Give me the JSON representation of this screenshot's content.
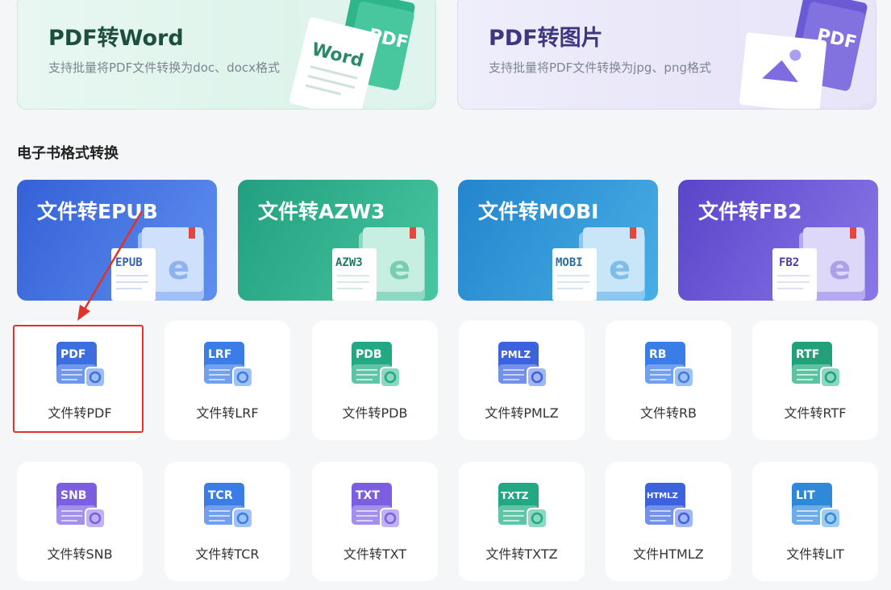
{
  "promos": [
    {
      "title": "PDF转Word",
      "subtitle": "支持批量将PDF文件转换为doc、docx格式",
      "badge": "Word",
      "badge2": "PDF"
    },
    {
      "title": "PDF转图片",
      "subtitle": "支持批量将PDF文件转换为jpg、png格式",
      "badge": "PDF"
    }
  ],
  "section_title": "电子书格式转换",
  "ebooks": [
    {
      "label": "文件转EPUB",
      "tag": "EPUB",
      "color": "#3d6fe0"
    },
    {
      "label": "文件转AZW3",
      "tag": "AZW3",
      "color": "#28a98a"
    },
    {
      "label": "文件转MOBI",
      "tag": "MOBI",
      "color": "#2d8fd6"
    },
    {
      "label": "文件转FB2",
      "tag": "FB2",
      "color": "#6c54d4"
    }
  ],
  "tiles_row1": [
    {
      "label": "文件转PDF",
      "icon_text": "PDF",
      "color": "#3c6ee0"
    },
    {
      "label": "文件转LRF",
      "icon_text": "LRF",
      "color": "#3a7de6"
    },
    {
      "label": "文件转PDB",
      "icon_text": "PDB",
      "color": "#23a884"
    },
    {
      "label": "文件转PMLZ",
      "icon_text": "PMLZ",
      "color": "#3c62de"
    },
    {
      "label": "文件转RB",
      "icon_text": "RB",
      "color": "#3a7de6"
    },
    {
      "label": "文件转RTF",
      "icon_text": "RTF",
      "color": "#22a07a"
    }
  ],
  "tiles_row2": [
    {
      "label": "文件转SNB",
      "icon_text": "SNB",
      "color": "#7b5fe0"
    },
    {
      "label": "文件转TCR",
      "icon_text": "TCR",
      "color": "#3a7de6"
    },
    {
      "label": "文件转TXT",
      "icon_text": "TXT",
      "color": "#7b5fe0"
    },
    {
      "label": "文件转TXTZ",
      "icon_text": "TXTZ",
      "color": "#23a884"
    },
    {
      "label": "文件HTMLZ",
      "icon_text": "HTMLZ",
      "color": "#3c62de"
    },
    {
      "label": "文件转LIT",
      "icon_text": "LIT",
      "color": "#2e8ad8"
    }
  ],
  "colors": {
    "highlight": "#e0322b"
  }
}
